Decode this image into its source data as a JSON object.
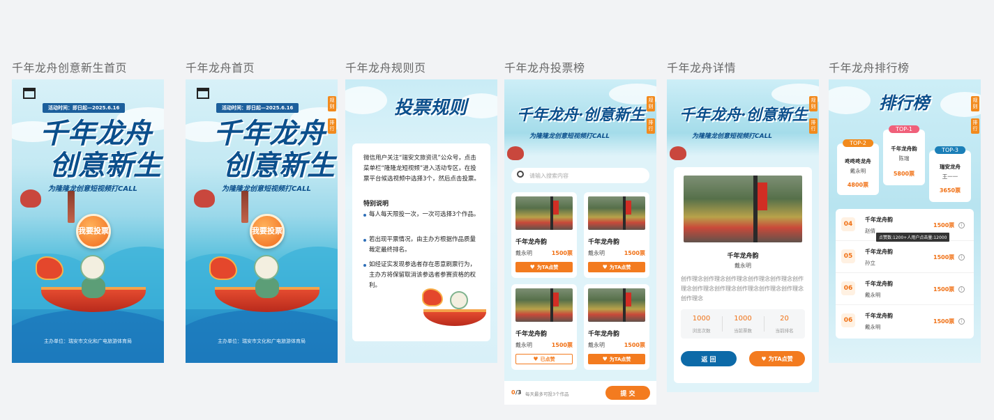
{
  "titles": [
    "千年龙舟创意新生首页",
    "千年龙舟首页",
    "千年龙舟规则页",
    "千年龙舟投票榜",
    "千年龙舟详情",
    "千年龙舟排行榜"
  ],
  "poster": {
    "date": "活动时间：即日起—2025.6.16",
    "title_line1": "千年龙舟",
    "title_line2": "创意新生",
    "slogan": "为隆隆龙创意短视频打CALL",
    "vote_btn": "我要投票",
    "organizer": "主办单位：瑞安市文化和广电旅游体育局"
  },
  "side_tabs": {
    "rules": "规则",
    "rank": "排行"
  },
  "rules": {
    "heading": "投票规则",
    "intro": "微信用户关注“瑞安文旅资讯”公众号，点击菜单栏“隆隆龙短视频”进入活动专区，在投票平台候选视频中选择3个，然后点击投票。",
    "special_title": "特别说明",
    "items": [
      "每人每天限投一次，一次可选择3个作品。",
      "若出现平票情况，由主办方根据作品质量裁定最终排名。",
      "如经证实发现参选者存在恶意刷票行为，主办方将保留取消该参选者参赛资格的权利。"
    ]
  },
  "vote": {
    "header_title": "千年龙舟·创意新生",
    "header_sub": "为隆隆龙创意短视频打CALL",
    "search_placeholder": "请输入搜索内容",
    "items": [
      {
        "name": "千年龙舟韵",
        "author": "戴永明",
        "votes": "1500票",
        "btn": "为TA点赞"
      },
      {
        "name": "千年龙舟韵",
        "author": "戴永明",
        "votes": "1500票",
        "btn": "为TA点赞"
      },
      {
        "name": "千年龙舟韵",
        "author": "戴永明",
        "votes": "1500票",
        "btn": "已点赞"
      },
      {
        "name": "千年龙舟韵",
        "author": "戴永明",
        "votes": "1500票",
        "btn": "为TA点赞"
      }
    ],
    "count_num": "0",
    "count_total": "/3",
    "count_hint": "每天最多可投3个作品",
    "submit": "提 交"
  },
  "detail": {
    "name": "千年龙舟韵",
    "author": "戴永明",
    "desc": "创作理念创作理念创作理念创作理念创作理念创作理念创作理念创作理念创作理念创作理念创作理念创作理念",
    "stats": [
      {
        "value": "1000",
        "label": "浏览次数"
      },
      {
        "value": "1000",
        "label": "当前票数"
      },
      {
        "value": "20",
        "label": "当前排名"
      }
    ],
    "back": "返 回",
    "like": "为TA点赞"
  },
  "ranking": {
    "heading": "排行榜",
    "top": [
      {
        "tag": "TOP-2",
        "name": "咚咚咚龙舟",
        "author": "戴永明",
        "votes": "4800票",
        "color": "#f28a1d"
      },
      {
        "tag": "TOP-1",
        "name": "千年龙舟韵",
        "author": "陈瑞",
        "votes": "5800票",
        "color": "#f0607a"
      },
      {
        "tag": "TOP-3",
        "name": "瑞安龙舟",
        "author": "王一一",
        "votes": "3650票",
        "color": "#1b7fb8"
      }
    ],
    "rows": [
      {
        "rank": "04",
        "name": "千年龙舟韵",
        "author": "赵倩",
        "votes": "1500票"
      },
      {
        "rank": "05",
        "name": "千年龙舟韵",
        "author": "孙立",
        "votes": "1500票"
      },
      {
        "rank": "06",
        "name": "千年龙舟韵",
        "author": "戴永明",
        "votes": "1500票"
      },
      {
        "rank": "06",
        "name": "千年龙舟韵",
        "author": "戴永明",
        "votes": "1500票"
      }
    ],
    "tooltip": "点赞数:1200+人用户点击量:12000"
  }
}
